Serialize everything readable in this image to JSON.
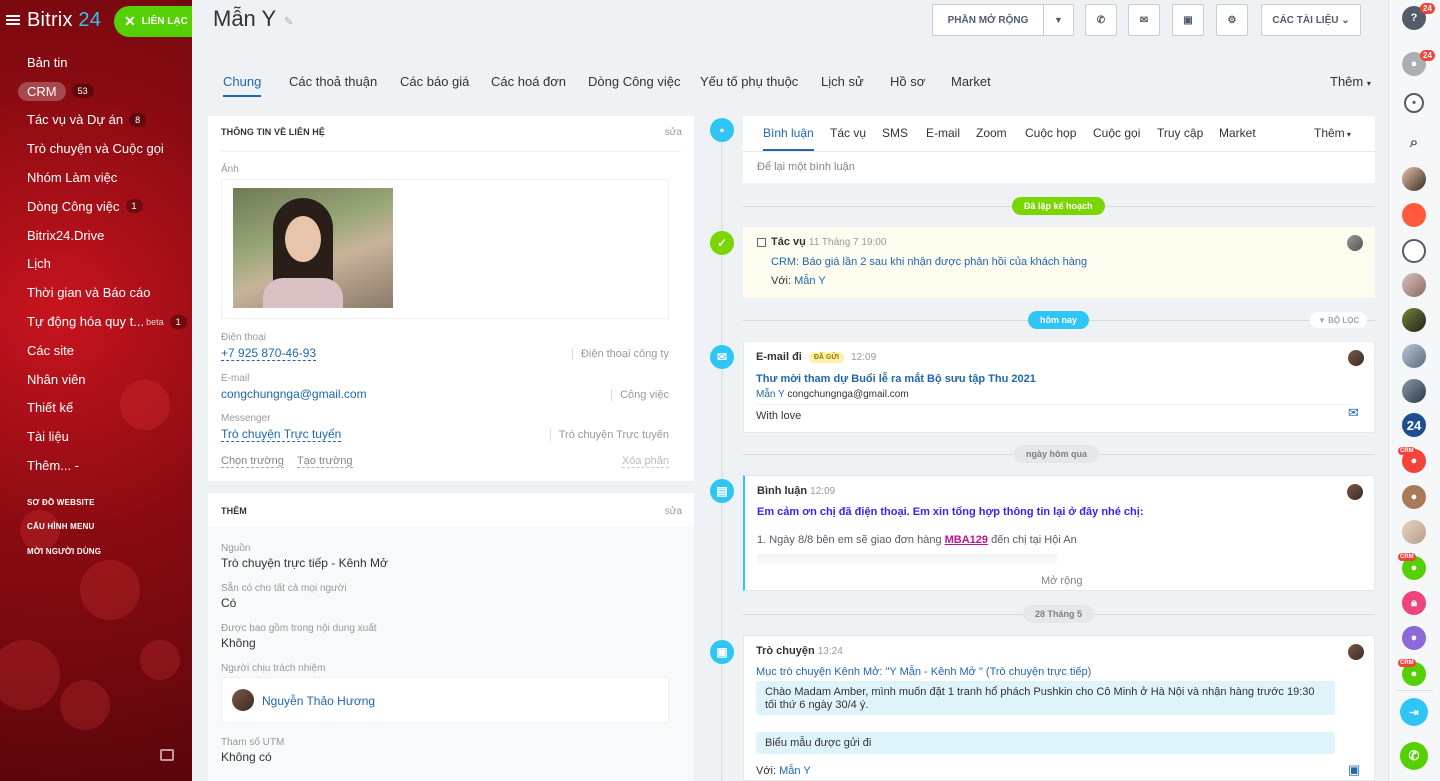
{
  "app": {
    "logo": "Bitrix",
    "logo_num": "24",
    "contact_button": "LIÊN LẠC"
  },
  "sidebar": {
    "items": [
      {
        "label": "Bản tin",
        "count": ""
      },
      {
        "label": "CRM",
        "count": "53",
        "active": true
      },
      {
        "label": "Tác vụ và Dự án",
        "count": "8"
      },
      {
        "label": "Trò chuyện và Cuộc gọi",
        "count": ""
      },
      {
        "label": "Nhóm Làm việc",
        "count": ""
      },
      {
        "label": "Dòng Công việc",
        "count": "1"
      },
      {
        "label": "Bitrix24.Drive",
        "count": ""
      },
      {
        "label": "Lịch",
        "count": ""
      },
      {
        "label": "Thời gian và Báo cáo",
        "count": ""
      },
      {
        "label": "Tự động hóa quy t...",
        "count": "1",
        "sup": "beta"
      },
      {
        "label": "Các site",
        "count": ""
      },
      {
        "label": "Nhân viên",
        "count": ""
      },
      {
        "label": "Thiết kế",
        "count": ""
      },
      {
        "label": "Tài liệu",
        "count": ""
      },
      {
        "label": "Thêm... -",
        "count": ""
      }
    ],
    "links": [
      "SƠ ĐỒ WEBSITE",
      "CẤU HÌNH MENU",
      "MỜI NGƯỜI DÙNG"
    ]
  },
  "header": {
    "title": "Mẫn Y",
    "extensions": "PHẦN MỞ RỘNG",
    "documents": "CÁC TÀI LIỆU"
  },
  "tabs": [
    "Chung",
    "Các thoả thuận",
    "Các báo giá",
    "Các hoá đơn",
    "Dòng Công việc",
    "Yếu tố phụ thuộc",
    "Lịch sử",
    "Hồ sơ",
    "Market",
    "Thêm"
  ],
  "contact_info": {
    "title": "THÔNG TIN VỀ LIÊN HỆ",
    "edit": "sửa",
    "photo_label": "Ảnh",
    "phone_label": "Điện thoại",
    "phone": "+7 925 870-46-93",
    "phone_type": "Điện thoại công ty",
    "email_label": "E-mail",
    "email": "congchungnga@gmail.com",
    "email_type": "Công việc",
    "messenger_label": "Messenger",
    "messenger": "Trò chuyện Trực tuyến",
    "messenger_type": "Trò chuyện Trực tuyến",
    "select_field": "Chọn trường",
    "create_field": "Tạo trường",
    "delete_section": "Xóa phần"
  },
  "more": {
    "title": "THÊM",
    "edit": "sửa",
    "source_label": "Nguồn",
    "source": "Trò chuyện trực tiếp - Kênh Mở",
    "available_label": "Sẵn có cho tất cả mọi người",
    "available": "Có",
    "export_label": "Được bao gồm trong nội dung xuất",
    "export": "Không",
    "responsible_label": "Người chịu trách nhiệm",
    "responsible": "Nguyễn Thảo Hương",
    "utm_label": "Tham số UTM",
    "utm": "Không có"
  },
  "timeline": {
    "tabs": [
      "Bình luận",
      "Tác vụ",
      "SMS",
      "E-mail",
      "Zoom",
      "Cuộc họp",
      "Cuộc gọi",
      "Truy cập",
      "Market",
      "Thêm"
    ],
    "comment_placeholder": "Để lại một bình luận",
    "planned": "Đã lập kế hoạch",
    "task": {
      "title": "Tác vụ",
      "time": "11 Tháng 7 19:00",
      "text": "CRM: Báo giá lần 2 sau khi nhận được phản hồi của khách hàng",
      "with_label": "Với:",
      "with": "Mẫn Y"
    },
    "today": "hôm nay",
    "filter": "BỘ LỌC",
    "email": {
      "title": "E-mail đi",
      "badge": "ĐÃ GỬI",
      "time": "12:09",
      "subject": "Thư mời tham dự Buổi lễ ra mắt Bộ sưu tập Thu 2021",
      "from_name": "Mẫn Y",
      "from_email": "congchungnga@gmail.com",
      "body": "With love"
    },
    "yesterday": "ngày hôm qua",
    "comment": {
      "title": "Bình luận",
      "time": "12:09",
      "headline": "Em cảm ơn chị đã điện thoại. Em xin tổng hợp thông tin lại ở đây nhé chị:",
      "line1_pre": "1. Ngày 8/8 bên em sẽ giao đơn hàng ",
      "line1_code": "MBA129",
      "line1_post": " đến chị tại Hội An",
      "expand": "Mở rộng"
    },
    "date": "28 Tháng 5",
    "chat": {
      "title": "Trò chuyện",
      "time": "13:24",
      "link": "Mục trò chuyện Kênh Mở: \"Y Mẫn - Kênh Mở \" (Trò chuyện trực tiếp)",
      "msg1": "Chào Madam Amber, mình muốn đặt 1 tranh hổ phách Pushkin cho Cô Minh ở Hà Nội và nhận hàng trước 19:30 tối thứ 6 ngày 30/4 ý.",
      "msg2": "Biểu mẫu được gửi đi",
      "with_label": "Với:",
      "with": "Mẫn Y"
    }
  },
  "rightbar": {
    "help_badge": "24",
    "notif_badge": "24",
    "b24": "24",
    "crm_tag": "CRM"
  },
  "colors": {
    "accent": "#2067b0",
    "green": "#55d005",
    "timeline_blue": "#2fc6f6",
    "sidebar_red": "#8b0b12"
  }
}
